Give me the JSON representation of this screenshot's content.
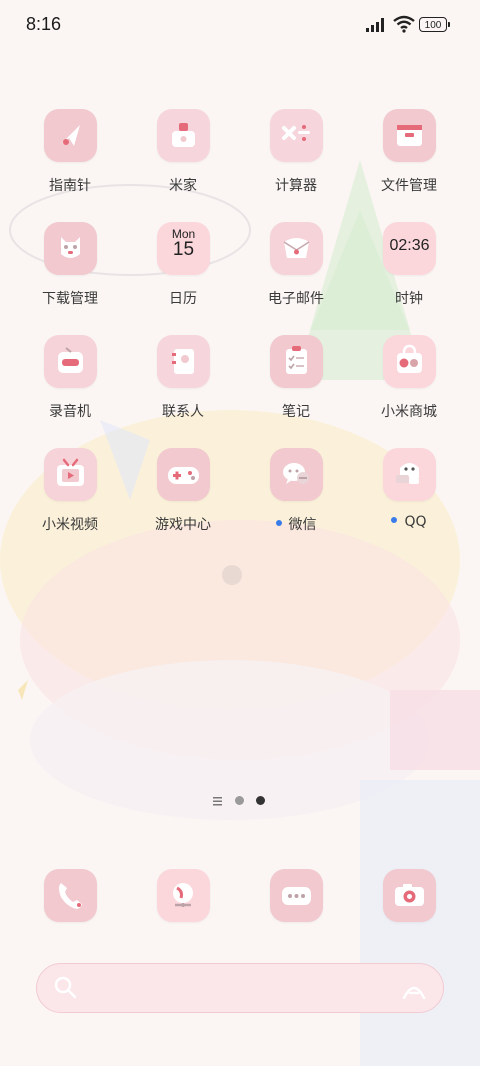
{
  "status": {
    "time": "8:16",
    "battery": "100"
  },
  "apps": [
    {
      "label": "指南针",
      "icon": "compass-icon"
    },
    {
      "label": "米家",
      "icon": "mijia-icon"
    },
    {
      "label": "计算器",
      "icon": "calculator-icon"
    },
    {
      "label": "文件管理",
      "icon": "file-manager-icon"
    },
    {
      "label": "下载管理",
      "icon": "download-manager-icon"
    },
    {
      "label": "日历",
      "icon": "calendar-icon",
      "day": "Mon",
      "date": "15"
    },
    {
      "label": "电子邮件",
      "icon": "email-icon"
    },
    {
      "label": "时钟",
      "icon": "clock-icon",
      "clock_time": "02:36"
    },
    {
      "label": "录音机",
      "icon": "recorder-icon"
    },
    {
      "label": "联系人",
      "icon": "contacts-icon"
    },
    {
      "label": "笔记",
      "icon": "notes-icon"
    },
    {
      "label": "小米商城",
      "icon": "mi-store-icon"
    },
    {
      "label": "小米视频",
      "icon": "mi-video-icon"
    },
    {
      "label": "游戏中心",
      "icon": "game-center-icon"
    },
    {
      "label": "微信",
      "icon": "wechat-icon",
      "new": true
    },
    {
      "label": "QQ",
      "icon": "qq-icon",
      "new": true
    }
  ],
  "dock": [
    {
      "icon": "phone-icon"
    },
    {
      "icon": "browser-icon"
    },
    {
      "icon": "messages-icon"
    },
    {
      "icon": "camera-icon"
    }
  ],
  "colors": {
    "icon_bg": "#f1c9cf",
    "icon_bg_light": "#f6d6dc",
    "accent_pink": "#e56b7a",
    "search_bg": "#fbe6ea"
  }
}
